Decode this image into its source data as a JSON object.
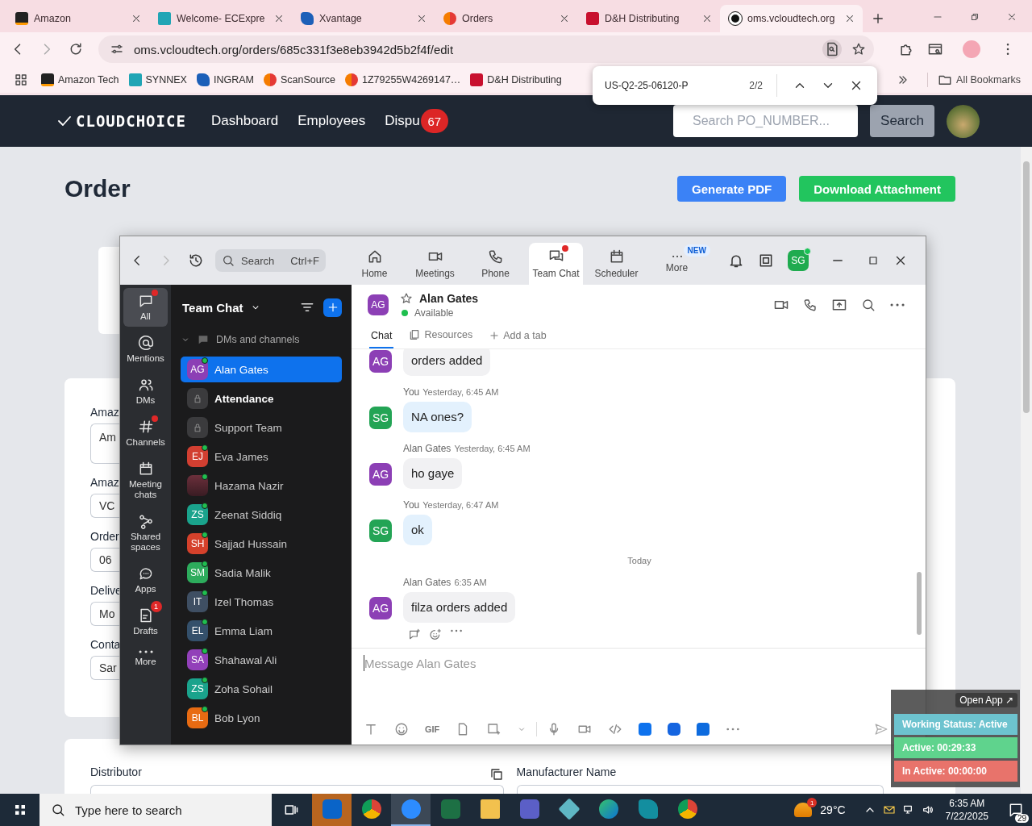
{
  "browser": {
    "tabs": [
      {
        "title": "Amazon",
        "kind": "amazon",
        "selected": false
      },
      {
        "title": "Welcome- ECExpre",
        "kind": "ec",
        "selected": false
      },
      {
        "title": "Xvantage",
        "kind": "xvantage",
        "selected": false
      },
      {
        "title": "Orders",
        "kind": "orders",
        "selected": false
      },
      {
        "title": "D&H Distributing",
        "kind": "dh",
        "selected": false
      },
      {
        "title": "oms.vcloudtech.org",
        "kind": "oms",
        "selected": true
      }
    ],
    "url": "oms.vcloudtech.org/orders/685c331f3e8eb3942d5b2f4f/edit",
    "bookmarks": [
      {
        "label": "Amazon Tech",
        "kind": "amazon"
      },
      {
        "label": "SYNNEX",
        "kind": "ec"
      },
      {
        "label": "INGRAM",
        "kind": "xvantage"
      },
      {
        "label": "ScanSource",
        "kind": "orders"
      },
      {
        "label": "1Z79255W4269147…",
        "kind": "orders"
      },
      {
        "label": "D&H Distributing",
        "kind": "dh"
      }
    ],
    "all_bookmarks": "All Bookmarks",
    "find_bar": {
      "query": "US-Q2-25-06120-P",
      "count": "2/2"
    }
  },
  "app_nav": {
    "logo": "CLOUDCHOICE",
    "links": [
      "Dashboard",
      "Employees",
      "Dispu"
    ],
    "badge": "67",
    "search": {
      "placeholder": "Search PO_NUMBER..."
    },
    "search_button": "Search"
  },
  "page": {
    "title": "Order",
    "buttons": [
      {
        "label": "Generate PDF",
        "kind": "primary"
      },
      {
        "label": "Download Attachment",
        "kind": "success"
      }
    ],
    "fields": [
      {
        "label": "Amaz",
        "value": "Am",
        "kind": "textarea"
      },
      {
        "label": "Amaz",
        "value": "VC",
        "kind": "input"
      },
      {
        "label": "Order",
        "value": "06",
        "kind": "input"
      },
      {
        "label": "Delive",
        "value": "Mo",
        "kind": "input"
      },
      {
        "label": "Conta",
        "value": "Sar",
        "kind": "input"
      }
    ],
    "lower_fields": [
      {
        "label": "Distributor",
        "copy": true
      },
      {
        "label": "Manufacturer Name",
        "copy": false
      }
    ]
  },
  "zoom": {
    "search": {
      "placeholder": "Search",
      "shortcut": "Ctrl+F"
    },
    "nav": [
      {
        "label": "Home",
        "selected": false,
        "dot": false
      },
      {
        "label": "Meetings",
        "selected": false,
        "dot": false
      },
      {
        "label": "Phone",
        "selected": false,
        "dot": false
      },
      {
        "label": "Team Chat",
        "selected": true,
        "dot": true
      },
      {
        "label": "Scheduler",
        "selected": false,
        "dot": false
      },
      {
        "label": "More",
        "selected": false,
        "dot": false,
        "badge": "NEW"
      }
    ],
    "user_initials": "SG",
    "rail": [
      {
        "label": "All",
        "selected": true,
        "dot": true
      },
      {
        "label": "Mentions",
        "selected": false,
        "dot": false
      },
      {
        "label": "DMs",
        "selected": false,
        "dot": false
      },
      {
        "label": "Channels",
        "selected": false,
        "dot": true
      },
      {
        "label": "Meeting chats",
        "selected": false,
        "dot": false
      },
      {
        "label": "Shared spaces",
        "selected": false,
        "dot": false
      },
      {
        "label": "Apps",
        "selected": false,
        "dot": false
      },
      {
        "label": "Drafts",
        "selected": false,
        "dot": false,
        "badge": "1"
      },
      {
        "label": "More",
        "selected": false,
        "dot": false
      }
    ],
    "list_title": "Team Chat",
    "section": {
      "label": "DMs and channels",
      "expanded": true
    },
    "contacts": [
      {
        "name": "Alan Gates",
        "kind": "dm",
        "initials": "AG",
        "color": "#8c3fb5",
        "selected": true,
        "unread": false,
        "online": true
      },
      {
        "name": "Attendance",
        "kind": "channel",
        "selected": false,
        "unread": true,
        "online": false
      },
      {
        "name": "Support Team",
        "kind": "channel",
        "selected": false,
        "unread": false,
        "online": false
      },
      {
        "name": "Eva James",
        "kind": "dm",
        "initials": "EJ",
        "color": "#d23f31",
        "selected": false,
        "unread": false,
        "online": true
      },
      {
        "name": "Hazama Nazir",
        "kind": "photo",
        "selected": false,
        "unread": false,
        "online": true
      },
      {
        "name": "Zeenat Siddiq",
        "kind": "dm",
        "initials": "ZS",
        "color": "#1aa38c",
        "selected": false,
        "unread": false,
        "online": true
      },
      {
        "name": "Sajjad Hussain",
        "kind": "dm",
        "initials": "SH",
        "color": "#d5412b",
        "selected": false,
        "unread": false,
        "online": true
      },
      {
        "name": "Sadia Malik",
        "kind": "dm",
        "initials": "SM",
        "color": "#2dac5c",
        "selected": false,
        "unread": false,
        "online": true
      },
      {
        "name": "Izel Thomas",
        "kind": "dm",
        "initials": "IT",
        "color": "#3f4f63",
        "selected": false,
        "unread": false,
        "online": true
      },
      {
        "name": "Emma Liam",
        "kind": "dm",
        "initials": "EL",
        "color": "#34506b",
        "selected": false,
        "unread": false,
        "online": true
      },
      {
        "name": "Shahawal Ali",
        "kind": "dm",
        "initials": "SA",
        "color": "#9240b9",
        "selected": false,
        "unread": false,
        "online": true
      },
      {
        "name": "Zoha Sohail",
        "kind": "dm",
        "initials": "ZS",
        "color": "#1aa38c",
        "selected": false,
        "unread": false,
        "online": true
      },
      {
        "name": "Bob Lyon",
        "kind": "dm",
        "initials": "BL",
        "color": "#e86b12",
        "selected": false,
        "unread": false,
        "online": true
      }
    ],
    "chat": {
      "name": "Alan Gates",
      "initials": "AG",
      "status": "Available",
      "tabs": [
        {
          "label": "Chat",
          "kind": "plain",
          "selected": true
        },
        {
          "label": "Resources",
          "kind": "resources",
          "selected": false
        },
        {
          "label": "Add a tab",
          "kind": "add",
          "selected": false
        }
      ],
      "messages": [
        {
          "kind": "message",
          "mine": false,
          "initials": "AG",
          "text": "orders added"
        },
        {
          "kind": "message",
          "mine": true,
          "initials": "SG",
          "sender": "You",
          "time": "Yesterday, 6:45 AM",
          "text": "NA ones?"
        },
        {
          "kind": "message",
          "mine": false,
          "initials": "AG",
          "sender": "Alan Gates",
          "time": "Yesterday, 6:45 AM",
          "text": "ho gaye"
        },
        {
          "kind": "message",
          "mine": true,
          "initials": "SG",
          "sender": "You",
          "time": "Yesterday, 6:47 AM",
          "text": "ok"
        },
        {
          "kind": "divider",
          "text": "Today"
        },
        {
          "kind": "message",
          "mine": false,
          "initials": "AG",
          "sender": "Alan Gates",
          "time": "6:35 AM",
          "text": "filza orders added",
          "actions": true
        }
      ],
      "composer": {
        "placeholder": "Message Alan Gates"
      },
      "gif_label": "GIF"
    }
  },
  "widget": {
    "open_app": "Open App ↗",
    "rows": [
      {
        "text": "Working Status: Active",
        "kind": "status"
      },
      {
        "text": "Active: 00:29:33",
        "kind": "active"
      },
      {
        "text": "In Active: 00:00:00",
        "kind": "inactive"
      }
    ]
  },
  "taskbar": {
    "search_placeholder": "Type here to search",
    "apps": [
      {
        "kind": "outlook",
        "selected": false,
        "attention": true
      },
      {
        "kind": "chrome",
        "selected": false,
        "attention": false
      },
      {
        "kind": "zoom",
        "selected": true,
        "attention": false
      },
      {
        "kind": "excel",
        "selected": false,
        "attention": false
      },
      {
        "kind": "explorer",
        "selected": false,
        "attention": false
      },
      {
        "kind": "teams",
        "selected": false,
        "attention": false
      },
      {
        "kind": "diamond",
        "selected": false,
        "attention": false
      },
      {
        "kind": "edge",
        "selected": false,
        "attention": false
      },
      {
        "kind": "sway",
        "selected": false,
        "attention": false
      },
      {
        "kind": "chrome",
        "selected": false,
        "attention": false
      }
    ],
    "weather": {
      "temp": "29°C",
      "badge": "1"
    },
    "time": "6:35 AM",
    "date": "7/22/2025",
    "notifications": "29"
  }
}
